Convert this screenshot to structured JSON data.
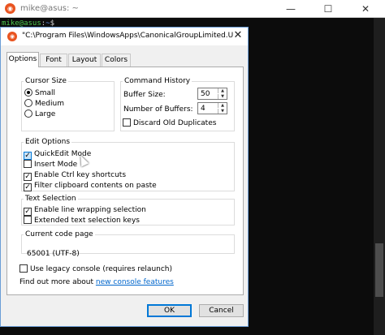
{
  "terminal": {
    "title": "mike@asus: ~",
    "prompt_user": "mike@asus",
    "prompt_sep": ":",
    "prompt_path": "~",
    "prompt_end": "$",
    "minimize_label": "—",
    "maximize_label": "☐",
    "close_label": "✕",
    "scroll_position": 0.82
  },
  "dialog": {
    "title": "\"C:\\Program Files\\WindowsApps\\CanonicalGroupLimited.U...",
    "close_label": "✕",
    "tabs": [
      {
        "label": "Options",
        "active": true
      },
      {
        "label": "Font",
        "active": false
      },
      {
        "label": "Layout",
        "active": false
      },
      {
        "label": "Colors",
        "active": false
      }
    ],
    "cursor_size": {
      "legend": "Cursor Size",
      "options": [
        {
          "label": "Small",
          "selected": true
        },
        {
          "label": "Medium",
          "selected": false
        },
        {
          "label": "Large",
          "selected": false
        }
      ]
    },
    "command_history": {
      "legend": "Command History",
      "buffer_size_label": "Buffer Size:",
      "buffer_size_value": "50",
      "num_buffers_label": "Number of Buffers:",
      "num_buffers_value": "4",
      "discard_label": "Discard Old Duplicates",
      "discard_checked": false
    },
    "edit_options": {
      "legend": "Edit Options",
      "items": [
        {
          "label": "QuickEdit Mode",
          "checked": true
        },
        {
          "label": "Insert Mode",
          "checked": false
        },
        {
          "label": "Enable Ctrl key shortcuts",
          "checked": true
        },
        {
          "label": "Filter clipboard contents on paste",
          "checked": true
        }
      ]
    },
    "text_selection": {
      "legend": "Text Selection",
      "items": [
        {
          "label": "Enable line wrapping selection",
          "checked": true
        },
        {
          "label": "Extended text selection keys",
          "checked": false
        }
      ]
    },
    "code_page": {
      "legend": "Current code page",
      "value": "65001 (UTF-8)"
    },
    "legacy_label": "Use legacy console (requires relaunch)",
    "legacy_checked": false,
    "find_out_text": "Find out more about",
    "find_out_link": "new console features",
    "ok_label": "OK",
    "cancel_label": "Cancel"
  },
  "icons": {
    "ubuntu": "ubuntu-icon",
    "check": "✓",
    "spin_up": "▲",
    "spin_down": "▼"
  }
}
